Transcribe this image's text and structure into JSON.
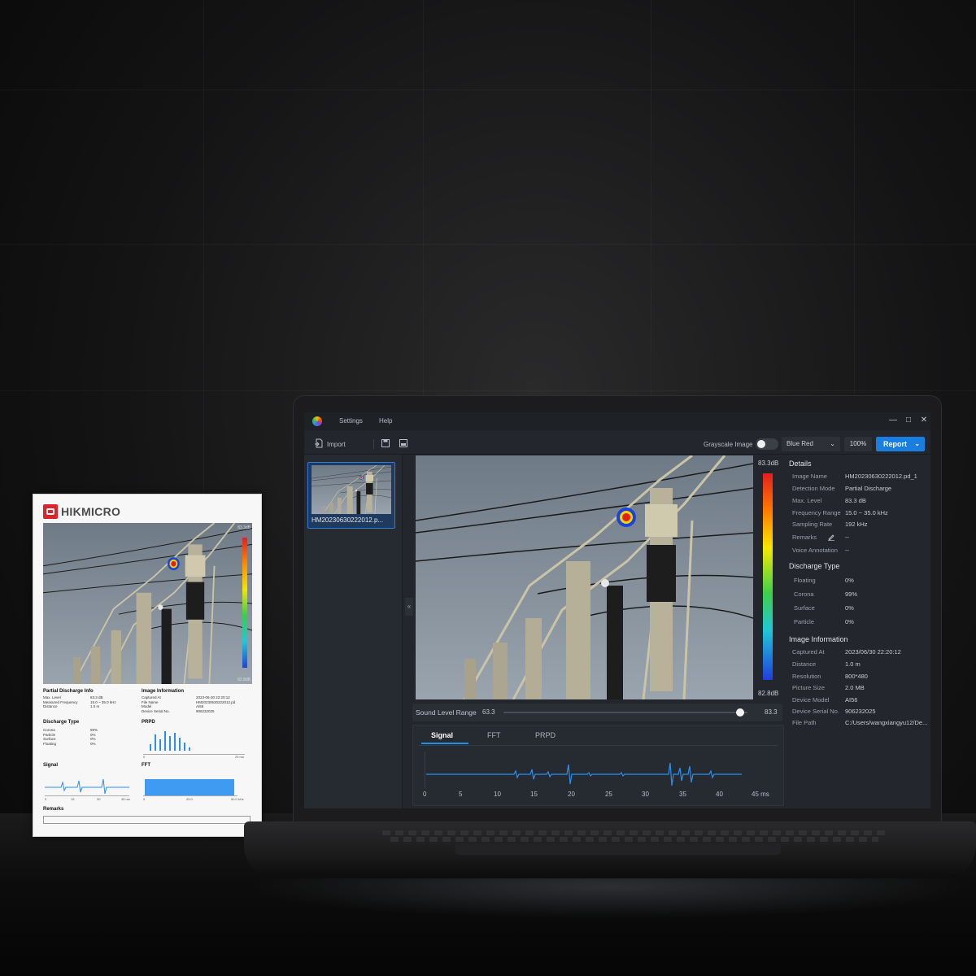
{
  "app": {
    "menu": [
      "Settings",
      "Help"
    ],
    "window_controls": [
      "—",
      "□",
      "✕"
    ]
  },
  "toolbar": {
    "import_label": "Import",
    "grayscale_label": "Grayscale Image",
    "palette_value": "Blue Red",
    "zoom_value": "100%",
    "report_label": "Report"
  },
  "thumbnail": {
    "caption": "HM20230630222012.p..."
  },
  "colorbar": {
    "max": "83.3dB",
    "min": "82.8dB"
  },
  "sound_level": {
    "label": "Sound Level Range",
    "min": "63.3",
    "max": "83.3",
    "level": 0.97
  },
  "signal_panel": {
    "tabs": [
      "Signal",
      "FFT",
      "PRPD"
    ],
    "active_tab": "Signal",
    "x_ticks": [
      "0",
      "5",
      "10",
      "15",
      "20",
      "25",
      "30",
      "35",
      "40",
      "45 ms"
    ]
  },
  "details": {
    "title": "Details",
    "rows": [
      {
        "k": "Image Name",
        "v": "HM20230630222012.pd_1"
      },
      {
        "k": "Detection Mode",
        "v": "Partial Discharge"
      },
      {
        "k": "Max. Level",
        "v": "83.3 dB"
      },
      {
        "k": "Frequency Range",
        "v": "15.0 ~ 35.0 kHz"
      },
      {
        "k": "Sampling Rate",
        "v": "192 kHz"
      },
      {
        "k": "Remarks",
        "v": "--"
      },
      {
        "k": "Voice Annotation",
        "v": "--"
      }
    ],
    "discharge_title": "Discharge Type",
    "discharge": [
      {
        "k": "Floating",
        "v": "0%"
      },
      {
        "k": "Corona",
        "v": "99%"
      },
      {
        "k": "Surface",
        "v": "0%"
      },
      {
        "k": "Particle",
        "v": "0%"
      }
    ],
    "image_info_title": "Image Information",
    "image_info": [
      {
        "k": "Captured At",
        "v": "2023/06/30 22:20:12"
      },
      {
        "k": "Distance",
        "v": "1.0 m"
      },
      {
        "k": "Resolution",
        "v": "800*480"
      },
      {
        "k": "Picture Size",
        "v": "2.0 MB"
      },
      {
        "k": "Device Model",
        "v": "AI56"
      },
      {
        "k": "Device Serial No.",
        "v": "906232025"
      },
      {
        "k": "File Path",
        "v": "C:/Users/wangxiangyu12/De..."
      }
    ]
  },
  "printed_report": {
    "brand": "HIKMICRO",
    "scale_max": "83.3dB",
    "scale_min": "82.8dB",
    "pd_title": "Partial Discharge Info",
    "pd_rows": [
      {
        "k": "Max. Level",
        "v": "83.3 dB"
      },
      {
        "k": "Measured Frequency",
        "v": "15.0 ~ 35.0 kHz"
      },
      {
        "k": "Distance",
        "v": "1.0 m"
      }
    ],
    "ii_title": "Image Information",
    "ii_rows": [
      {
        "k": "Captured At",
        "v": "2023-06-30 22:20:12"
      },
      {
        "k": "File Name",
        "v": "HM20230630222012.pd"
      },
      {
        "k": "Model",
        "v": "AI56"
      },
      {
        "k": "Device Serial No.",
        "v": "906232025"
      }
    ],
    "dt_title": "Discharge Type",
    "dt_rows": [
      {
        "k": "Corona",
        "v": "99%"
      },
      {
        "k": "Particle",
        "v": "0%"
      },
      {
        "k": "Surface",
        "v": "0%"
      },
      {
        "k": "Floating",
        "v": "0%"
      }
    ],
    "prpd_title": "PRPD",
    "signal_title": "Signal",
    "fft_title": "FFT",
    "remarks_title": "Remarks",
    "prpd_axis": [
      "0",
      "25 ms"
    ],
    "signal_axis": [
      "0",
      "15",
      "30",
      "45 ms"
    ],
    "fft_axis": [
      "0",
      "25.0",
      "50.0 kHz"
    ]
  },
  "colors": {
    "accent": "#1a7de0",
    "app_bg": "#23262c",
    "signal_line": "#2a8ff0"
  }
}
